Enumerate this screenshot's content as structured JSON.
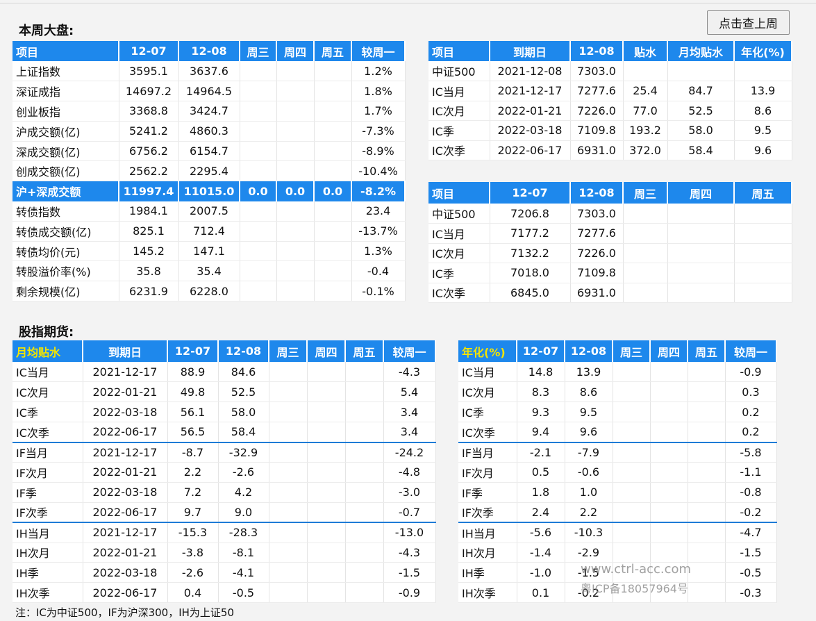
{
  "titles": {
    "weekly": "本周大盘:",
    "futures": "股指期货:"
  },
  "button_label": "点击查上周",
  "market": {
    "headers": [
      "项目",
      "12-07",
      "12-08",
      "周三",
      "周四",
      "周五",
      "较周一"
    ],
    "rows": [
      [
        "上证指数",
        "3595.1",
        "3637.6",
        "",
        "",
        "",
        "1.2%"
      ],
      [
        "深证成指",
        "14697.2",
        "14964.5",
        "",
        "",
        "",
        "1.8%"
      ],
      [
        "创业板指",
        "3368.8",
        "3424.7",
        "",
        "",
        "",
        "1.7%"
      ],
      [
        "沪成交额(亿)",
        "5241.2",
        "4860.3",
        "",
        "",
        "",
        "-7.3%"
      ],
      [
        "深成交额(亿)",
        "6756.2",
        "6154.7",
        "",
        "",
        "",
        "-8.9%"
      ],
      [
        "创成交额(亿)",
        "2562.2",
        "2295.4",
        "",
        "",
        "",
        "-10.4%"
      ],
      [
        "沪+深成交额",
        "11997.4",
        "11015.0",
        "0.0",
        "0.0",
        "0.0",
        "-8.2%"
      ],
      [
        "转债指数",
        "1984.1",
        "2007.5",
        "",
        "",
        "",
        "23.4"
      ],
      [
        "转债成交额(亿)",
        "825.1",
        "712.4",
        "",
        "",
        "",
        "-13.7%"
      ],
      [
        "转债均价(元)",
        "145.2",
        "147.1",
        "",
        "",
        "",
        "1.3%"
      ],
      [
        "转股溢价率(%)",
        "35.8",
        "35.4",
        "",
        "",
        "",
        "-0.4"
      ],
      [
        "剩余规模(亿)",
        "6231.9",
        "6228.0",
        "",
        "",
        "",
        "-0.1%"
      ]
    ]
  },
  "basis": {
    "headers": [
      "项目",
      "到期日",
      "12-08",
      "贴水",
      "月均贴水",
      "年化(%)"
    ],
    "rows": [
      [
        "中证500",
        "2021-12-08",
        "7303.0",
        "",
        "",
        ""
      ],
      [
        "IC当月",
        "2021-12-17",
        "7277.6",
        "25.4",
        "84.7",
        "13.9"
      ],
      [
        "IC次月",
        "2022-01-21",
        "7226.0",
        "77.0",
        "52.5",
        "8.6"
      ],
      [
        "IC季",
        "2022-03-18",
        "7109.8",
        "193.2",
        "58.0",
        "9.5"
      ],
      [
        "IC次季",
        "2022-06-17",
        "6931.0",
        "372.0",
        "58.4",
        "9.6"
      ]
    ]
  },
  "prices": {
    "headers": [
      "项目",
      "12-07",
      "12-08",
      "周三",
      "周四",
      "周五"
    ],
    "rows": [
      [
        "中证500",
        "7206.8",
        "7303.0",
        "",
        "",
        ""
      ],
      [
        "IC当月",
        "7177.2",
        "7277.6",
        "",
        "",
        ""
      ],
      [
        "IC次月",
        "7132.2",
        "7226.0",
        "",
        "",
        ""
      ],
      [
        "IC季",
        "7018.0",
        "7109.8",
        "",
        "",
        ""
      ],
      [
        "IC次季",
        "6845.0",
        "6931.0",
        "",
        "",
        ""
      ]
    ]
  },
  "monthly": {
    "headers": [
      "月均贴水",
      "到期日",
      "12-07",
      "12-08",
      "周三",
      "周四",
      "周五",
      "较周一"
    ],
    "rows": [
      [
        "IC当月",
        "2021-12-17",
        "88.9",
        "84.6",
        "",
        "",
        "",
        "-4.3"
      ],
      [
        "IC次月",
        "2022-01-21",
        "49.8",
        "52.5",
        "",
        "",
        "",
        "5.4"
      ],
      [
        "IC季",
        "2022-03-18",
        "56.1",
        "58.0",
        "",
        "",
        "",
        "3.4"
      ],
      [
        "IC次季",
        "2022-06-17",
        "56.5",
        "58.4",
        "",
        "",
        "",
        "3.4"
      ],
      [
        "IF当月",
        "2021-12-17",
        "-8.7",
        "-32.9",
        "",
        "",
        "",
        "-24.2"
      ],
      [
        "IF次月",
        "2022-01-21",
        "2.2",
        "-2.6",
        "",
        "",
        "",
        "-4.8"
      ],
      [
        "IF季",
        "2022-03-18",
        "7.2",
        "4.2",
        "",
        "",
        "",
        "-3.0"
      ],
      [
        "IF次季",
        "2022-06-17",
        "9.7",
        "9.0",
        "",
        "",
        "",
        "-0.7"
      ],
      [
        "IH当月",
        "2021-12-17",
        "-15.3",
        "-28.3",
        "",
        "",
        "",
        "-13.0"
      ],
      [
        "IH次月",
        "2022-01-21",
        "-3.8",
        "-8.1",
        "",
        "",
        "",
        "-4.3"
      ],
      [
        "IH季",
        "2022-03-18",
        "-2.6",
        "-4.1",
        "",
        "",
        "",
        "-1.5"
      ],
      [
        "IH次季",
        "2022-06-17",
        "0.4",
        "-0.5",
        "",
        "",
        "",
        "-0.9"
      ]
    ]
  },
  "annual": {
    "headers": [
      "年化(%)",
      "12-07",
      "12-08",
      "周三",
      "周四",
      "周五",
      "较周一"
    ],
    "rows": [
      [
        "IC当月",
        "14.8",
        "13.9",
        "",
        "",
        "",
        "-0.9"
      ],
      [
        "IC次月",
        "8.3",
        "8.6",
        "",
        "",
        "",
        "0.3"
      ],
      [
        "IC季",
        "9.3",
        "9.5",
        "",
        "",
        "",
        "0.2"
      ],
      [
        "IC次季",
        "9.4",
        "9.6",
        "",
        "",
        "",
        "0.2"
      ],
      [
        "IF当月",
        "-2.1",
        "-7.9",
        "",
        "",
        "",
        "-5.8"
      ],
      [
        "IF次月",
        "0.5",
        "-0.6",
        "",
        "",
        "",
        "-1.1"
      ],
      [
        "IF季",
        "1.8",
        "1.0",
        "",
        "",
        "",
        "-0.8"
      ],
      [
        "IF次季",
        "2.4",
        "2.2",
        "",
        "",
        "",
        "-0.2"
      ],
      [
        "IH当月",
        "-5.6",
        "-10.3",
        "",
        "",
        "",
        "-4.7"
      ],
      [
        "IH次月",
        "-1.4",
        "-2.9",
        "",
        "",
        "",
        "-1.5"
      ],
      [
        "IH季",
        "-1.0",
        "-1.5",
        "",
        "",
        "",
        "-0.5"
      ],
      [
        "IH次季",
        "0.1",
        "-0.2",
        "",
        "",
        "",
        "-0.3"
      ]
    ]
  },
  "note": "注：IC为中证500，IF为沪深300，IH为上证50",
  "watermark": {
    "line1": "www.ctrl-acc.com",
    "line2": "粤ICP备18057964号"
  },
  "colors": {
    "header_blue": "#1e88ec",
    "header_highlight_text": "#f3e400"
  }
}
